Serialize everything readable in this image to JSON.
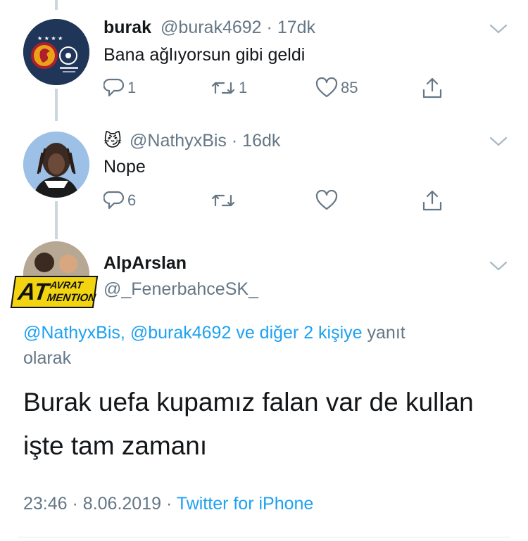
{
  "tweets": [
    {
      "name": "burak",
      "handle": "@burak4692",
      "dot": "·",
      "time": "17dk",
      "text": "Bana ağlıyorsun gibi geldi",
      "replies": "1",
      "retweets": "1",
      "likes": "85"
    },
    {
      "name_emoji": "😼",
      "handle": "@NathyxBis",
      "dot": "·",
      "time": "16dk",
      "text": "Nope",
      "replies": "6"
    }
  ],
  "main": {
    "name": "AlpArslan",
    "handle": "@_FenerbahceSK_",
    "avatar_badge": {
      "big": "AT",
      "top": "AVRAT",
      "bottom": "MENTION"
    },
    "reply_to": {
      "mention1": "@NathyxBis,",
      "mention2": "@burak4692",
      "others": "ve diğer 2 kişiye",
      "suffix_line1": "yanıt",
      "suffix_line2": "olarak"
    },
    "text_line1": "Burak uefa kupamız falan var de kullan",
    "text_line2": "işte tam zamanı",
    "time": "23:46",
    "dot": "·",
    "date": "8.06.2019",
    "source": "Twitter for iPhone"
  },
  "icons": {
    "reply": "reply-icon",
    "retweet": "retweet-icon",
    "like": "heart-icon",
    "share": "share-icon",
    "more": "chevron-down-icon"
  },
  "colors": {
    "link": "#1da1f2",
    "muted": "#657786",
    "text": "#14171a",
    "line": "#ccd6dd"
  }
}
